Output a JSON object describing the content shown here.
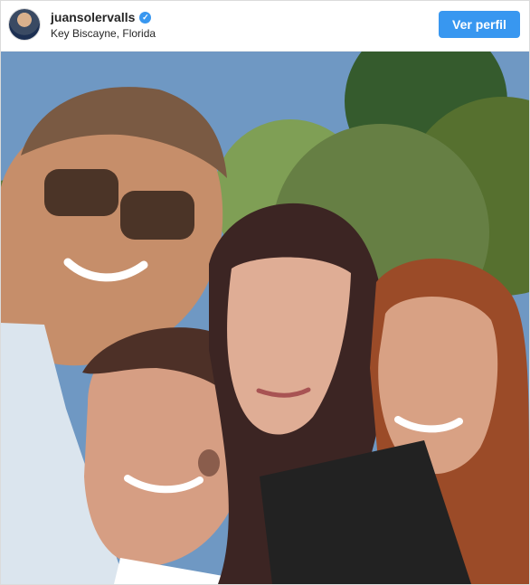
{
  "header": {
    "username": "juansolervalls",
    "verified": true,
    "location": "Key Biscayne, Florida",
    "view_profile_label": "Ver perfil"
  },
  "icons": {
    "avatar": "avatar",
    "verified": "verified-check-icon"
  },
  "colors": {
    "accent": "#3897f0",
    "text": "#262626",
    "border": "#dbdbdb"
  }
}
